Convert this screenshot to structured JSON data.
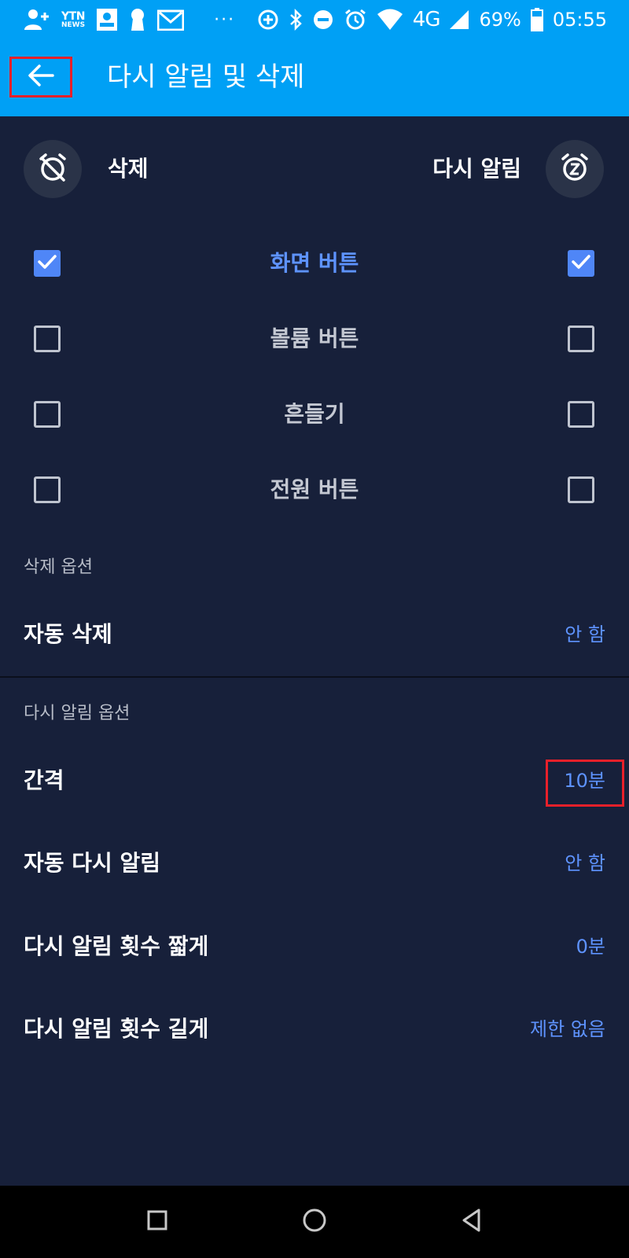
{
  "status_bar": {
    "ytn_line1": "YTN",
    "ytn_line2": "NEWS",
    "more": "···",
    "network": "4G",
    "battery": "69%",
    "time": "05:55",
    "icons": [
      "add-contact-icon",
      "ytn-news-icon",
      "contact-card-icon",
      "keyhole-icon",
      "gmail-icon",
      "data-saver-icon",
      "bluetooth-icon",
      "do-not-disturb-icon",
      "alarm-icon",
      "wifi-icon",
      "signal-icon",
      "battery-icon"
    ]
  },
  "app_bar": {
    "title": "다시 알림 및 삭제",
    "background_color": "#00a0f5"
  },
  "header": {
    "delete_label": "삭제",
    "snooze_label": "다시 알림"
  },
  "triggers": [
    {
      "label": "화면 버튼",
      "delete_checked": true,
      "snooze_checked": true
    },
    {
      "label": "볼륨 버튼",
      "delete_checked": false,
      "snooze_checked": false
    },
    {
      "label": "흔들기",
      "delete_checked": false,
      "snooze_checked": false
    },
    {
      "label": "전원 버튼",
      "delete_checked": false,
      "snooze_checked": false
    }
  ],
  "delete_options": {
    "section_title": "삭제 옵션",
    "auto_delete": {
      "label": "자동 삭제",
      "value": "안 함"
    }
  },
  "snooze_options": {
    "section_title": "다시 알림 옵션",
    "interval": {
      "label": "간격",
      "value": "10분"
    },
    "auto_snooze": {
      "label": "자동 다시 알림",
      "value": "안 함"
    },
    "shorten": {
      "label": "다시 알림 횟수 짧게",
      "value": "0분"
    },
    "lengthen": {
      "label": "다시 알림 횟수 길게",
      "value": "제한 없음"
    }
  },
  "colors": {
    "background": "#17203a",
    "accent": "#5e93ff",
    "highlight_box": "#e8202a"
  }
}
